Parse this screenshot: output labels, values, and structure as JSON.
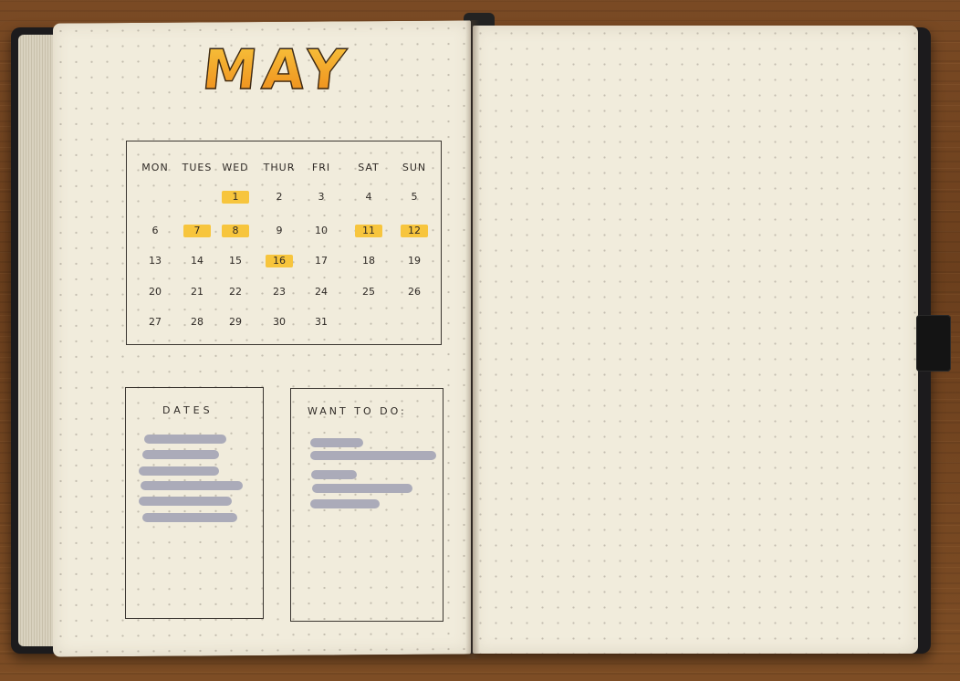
{
  "month_title": "MAY",
  "calendar": {
    "weekdays": [
      "MON",
      "TUES",
      "WED",
      "THUR",
      "FRI",
      "SAT",
      "SUN"
    ],
    "highlighted_days": [
      "1",
      "7",
      "8",
      "11",
      "12",
      "16"
    ],
    "highlight_color": "#f7c53d",
    "weeks": [
      [
        "",
        "",
        "1",
        "2",
        "3",
        "4",
        "5"
      ],
      [
        "6",
        "7",
        "8",
        "9",
        "10",
        "11",
        "12"
      ],
      [
        "13",
        "14",
        "15",
        "16",
        "17",
        "18",
        "19"
      ],
      [
        "20",
        "21",
        "22",
        "23",
        "24",
        "25",
        "26"
      ],
      [
        "27",
        "28",
        "29",
        "30",
        "31",
        "",
        ""
      ]
    ]
  },
  "dates_box": {
    "title": "DATES"
  },
  "todo_box": {
    "title": "WANT TO DO:"
  },
  "colors": {
    "title_gradient": [
      "#f7c63e",
      "#e98a1c"
    ],
    "paper": "#f1ecdc",
    "cover": "#1c1b1d",
    "redaction": "#a6a8b6"
  }
}
